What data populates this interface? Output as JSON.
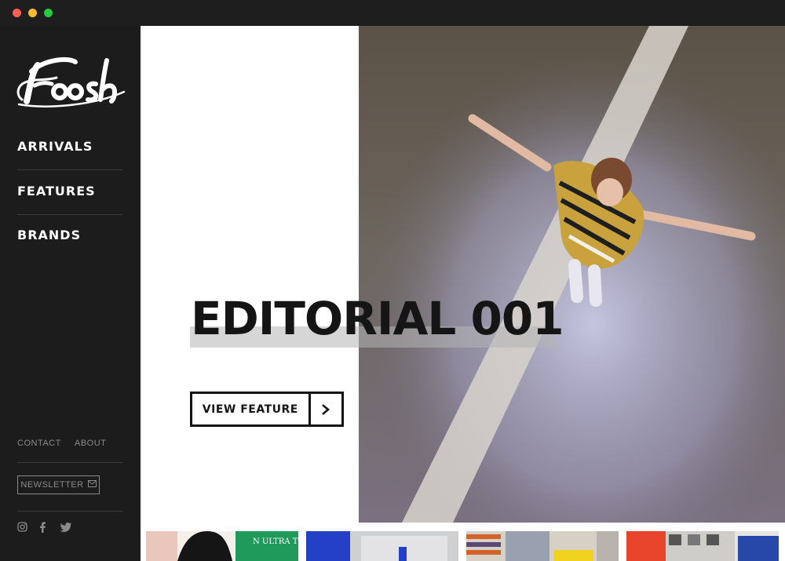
{
  "window": {
    "controls": [
      "close",
      "minimize",
      "maximize"
    ]
  },
  "sidebar": {
    "logo_text": "Foosh",
    "nav": [
      {
        "label": "ARRIVALS"
      },
      {
        "label": "FEATURES"
      },
      {
        "label": "BRANDS"
      }
    ],
    "footer_links": [
      {
        "label": "CONTACT"
      },
      {
        "label": "ABOUT"
      }
    ],
    "newsletter_label": "NEWSLETTER",
    "newsletter_icon": "mail-icon",
    "social": [
      "instagram-icon",
      "facebook-icon",
      "twitter-icon"
    ]
  },
  "hero": {
    "title": "EDITORIAL 001",
    "cta_label": "VIEW FEATURE",
    "cta_icon": "chevron-right-icon"
  },
  "thumbnails": [
    {
      "caption_text": "N ULTRA THIS"
    },
    {
      "caption_text": ""
    },
    {
      "caption_text": ""
    },
    {
      "caption_text": ""
    }
  ],
  "colors": {
    "sidebar_bg": "#1c1c1c",
    "accent_dark": "#151515",
    "muted_text": "#8a8a8a"
  }
}
